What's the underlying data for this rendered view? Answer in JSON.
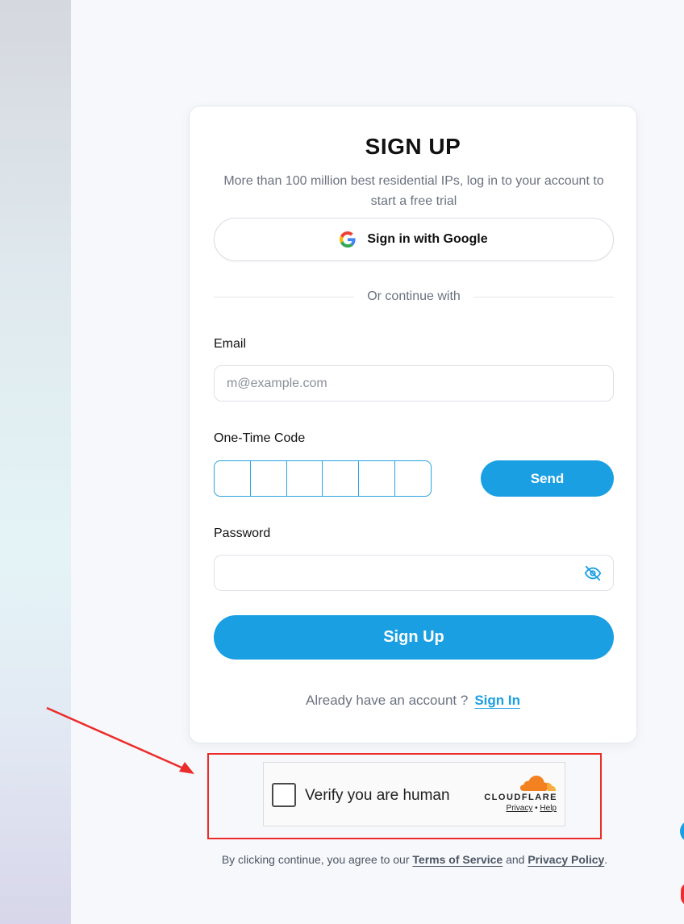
{
  "signup": {
    "title": "SIGN UP",
    "subtitle": "More than 100 million best residential IPs, log in to your account to start a free trial",
    "google_label": "Sign in with Google",
    "divider_text": "Or continue with",
    "email_label": "Email",
    "email_placeholder": "m@example.com",
    "otp_label": "One-Time Code",
    "send_label": "Send",
    "password_label": "Password",
    "submit_label": "Sign Up",
    "account_prompt": "Already have an account ?",
    "signin_link": "Sign In"
  },
  "turnstile": {
    "verify_text": "Verify you are human",
    "brand": "CLOUDFLARE",
    "privacy_link": "Privacy",
    "separator": "•",
    "help_link": "Help"
  },
  "terms": {
    "prefix": "By clicking continue, you agree to our",
    "tos_link": "Terms of Service",
    "conjunction": "and",
    "privacy_link": "Privacy Policy",
    "suffix": "."
  },
  "colors": {
    "accent": "#1a9fe3",
    "annotation_red": "#ec2b2b",
    "cloudflare_orange": "#f48120"
  },
  "icons": {
    "google": "google-g-icon",
    "password_toggle": "eye-off-icon",
    "cloudflare": "cloudflare-cloud-icon"
  }
}
